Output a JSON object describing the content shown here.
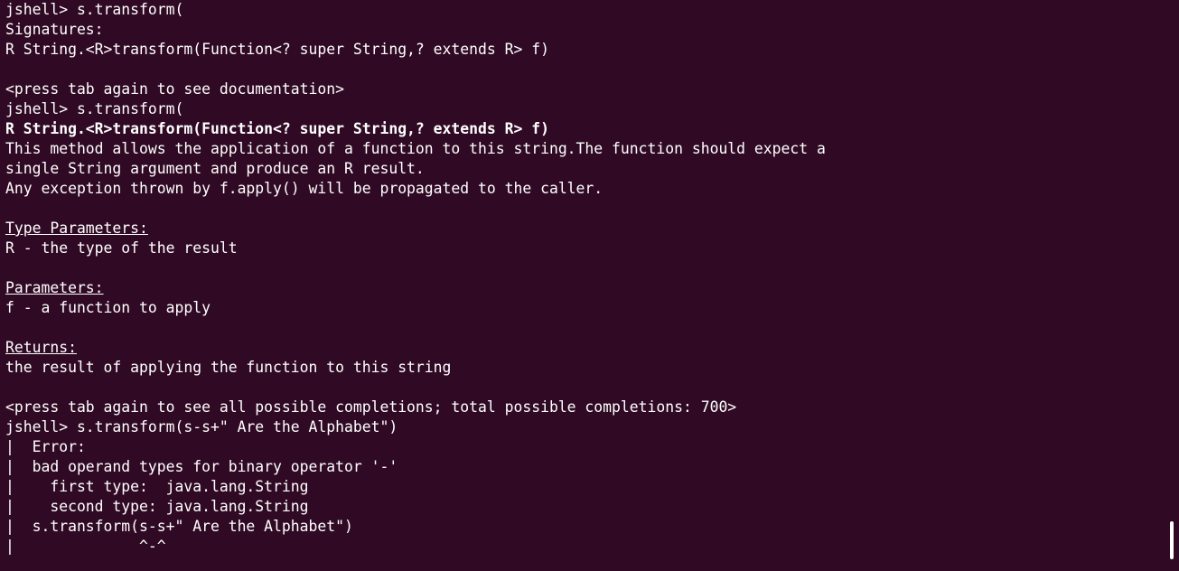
{
  "terminal": {
    "lines": [
      "jshell> s.transform(",
      "Signatures:",
      "R String.<R>transform(Function<? super String,? extends R> f)",
      "",
      "<press tab again to see documentation>",
      "jshell> s.transform(",
      "R String.<R>transform(Function<? super String,? extends R> f)",
      "This method allows the application of a function to this string.The function should expect a",
      "single String argument and produce an R result.",
      "Any exception thrown by f.apply() will be propagated to the caller.",
      "",
      "Type Parameters:",
      "R - the type of the result",
      "",
      "Parameters:",
      "f - a function to apply",
      "",
      "Returns:",
      "the result of applying the function to this string",
      "",
      "<press tab again to see all possible completions; total possible completions: 700>",
      "jshell> s.transform(s-s+\" Are the Alphabet\")",
      "|  Error:",
      "|  bad operand types for binary operator '-'",
      "|    first type:  java.lang.String",
      "|    second type: java.lang.String",
      "|  s.transform(s-s+\" Are the Alphabet\")",
      "|              ^-^"
    ]
  },
  "colors": {
    "background": "#300a24",
    "foreground": "#ffffff"
  }
}
